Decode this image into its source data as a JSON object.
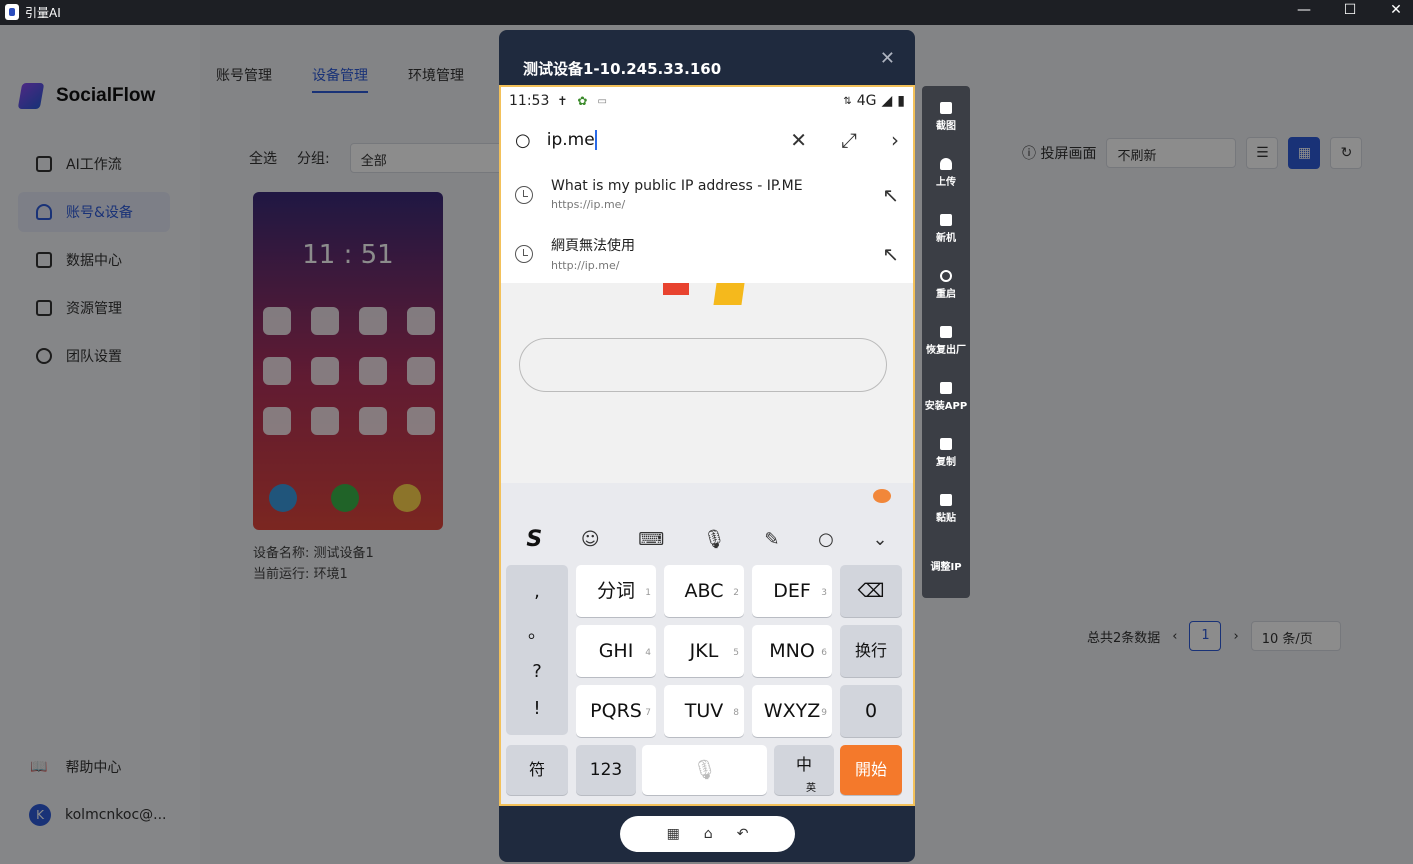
{
  "window": {
    "title": "引量AI",
    "controls": [
      "—",
      "☐",
      "✕"
    ]
  },
  "sidebar": {
    "brand": "SocialFlow",
    "items": [
      {
        "label": "AI工作流",
        "icon": "list-icon",
        "active": false
      },
      {
        "label": "账号&设备",
        "icon": "users-icon",
        "active": true
      },
      {
        "label": "数据中心",
        "icon": "data-icon",
        "active": false
      },
      {
        "label": "资源管理",
        "icon": "grid-icon",
        "active": false
      },
      {
        "label": "团队设置",
        "icon": "gear-icon",
        "active": false
      }
    ],
    "help": "帮助中心",
    "user": {
      "initial": "K",
      "name": "kolmcnkoc@..."
    }
  },
  "main": {
    "tabs": [
      "账号管理",
      "设备管理",
      "环境管理"
    ],
    "active_tab": "设备管理",
    "filters": {
      "select_all": "全选",
      "group_label": "分组:",
      "group_value": "全部"
    },
    "screencast_label": "投屏画面",
    "refresh_value": "不刷新",
    "device": {
      "thumb_time": "11 : 51",
      "name_line": "设备名称:  测试设备1",
      "run_line": "当前运行: 环境1"
    },
    "pagination": {
      "total": "总共2条数据",
      "page": "1",
      "per_page": "10 条/页"
    }
  },
  "modal": {
    "title": "测试设备1-10.245.33.160",
    "close": "✕",
    "status": {
      "time": "11:53",
      "network": "4G"
    },
    "search": {
      "query": "ip.me"
    },
    "suggestions": [
      {
        "title": "What is my public IP address - IP.ME",
        "url": "https://ip.me/"
      },
      {
        "title": "網頁無法使用",
        "url": "http://ip.me/"
      }
    ],
    "keyboard": {
      "logo": "S",
      "punct": [
        ",",
        "。",
        "?",
        "!"
      ],
      "rows": [
        [
          {
            "label": "分词",
            "num": "1"
          },
          {
            "label": "ABC",
            "num": "2"
          },
          {
            "label": "DEF",
            "num": "3"
          }
        ],
        [
          {
            "label": "GHI",
            "num": "4"
          },
          {
            "label": "JKL",
            "num": "5"
          },
          {
            "label": "MNO",
            "num": "6"
          }
        ],
        [
          {
            "label": "PQRS",
            "num": "7"
          },
          {
            "label": "TUV",
            "num": "8"
          },
          {
            "label": "WXYZ",
            "num": "9"
          }
        ]
      ],
      "newline": "换行",
      "zero": "0",
      "symbols": "符",
      "numbers": "123",
      "lang": "中",
      "lang_sub": "英",
      "go": "開始"
    },
    "nav": [
      "▦",
      "⌂",
      "↶"
    ]
  },
  "toolbar": {
    "items": [
      {
        "label": "截图",
        "icon": "screenshot-icon"
      },
      {
        "label": "上传",
        "icon": "upload-icon"
      },
      {
        "label": "新机",
        "icon": "new-device-icon"
      },
      {
        "label": "重启",
        "icon": "power-icon"
      },
      {
        "label": "恢复出厂",
        "icon": "factory-reset-icon"
      },
      {
        "label": "安装APP",
        "icon": "install-icon"
      },
      {
        "label": "复制",
        "icon": "copy-icon"
      },
      {
        "label": "黏贴",
        "icon": "paste-icon"
      },
      {
        "label": "调整IP",
        "icon": "ip-icon"
      }
    ]
  }
}
